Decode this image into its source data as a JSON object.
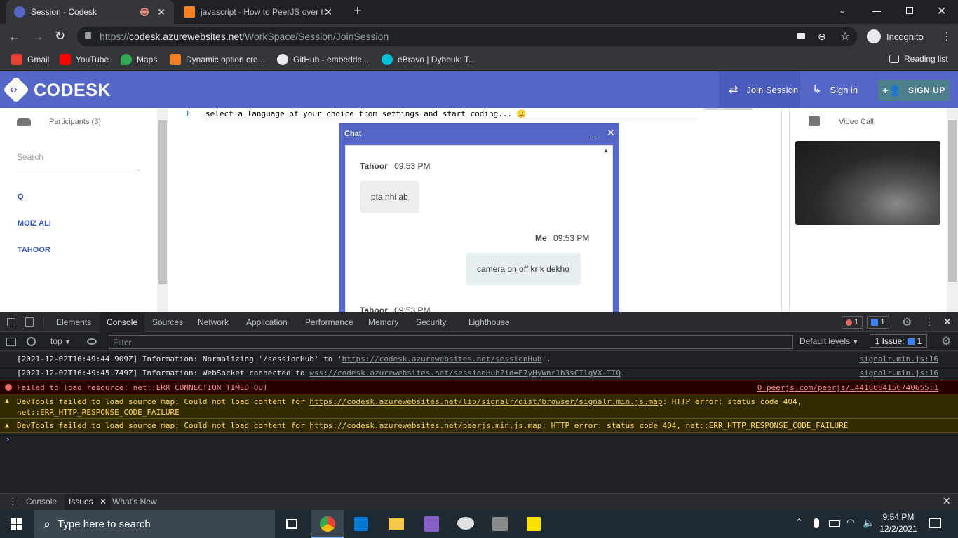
{
  "browser": {
    "tabs": [
      {
        "title": "Session - Codesk",
        "active": true,
        "recording": true
      },
      {
        "title": "javascript - How to PeerJS over th",
        "active": false
      }
    ],
    "address": {
      "scheme": "https://",
      "host": "codesk.azurewebsites.net",
      "path": "/WorkSpace/Session/JoinSession"
    },
    "profile": "Incognito",
    "bookmarks": [
      {
        "label": "Gmail",
        "icon": "gmail-icon"
      },
      {
        "label": "YouTube",
        "icon": "youtube-icon"
      },
      {
        "label": "Maps",
        "icon": "maps-icon"
      },
      {
        "label": "Dynamic option cre...",
        "icon": "stackoverflow-icon"
      },
      {
        "label": "GitHub - embedde...",
        "icon": "github-icon"
      },
      {
        "label": "eBravo | Dybbuk: T...",
        "icon": "ebravo-icon"
      }
    ],
    "reading_list": "Reading list"
  },
  "app": {
    "brand": "CODESK",
    "nav": {
      "join_session": "Join Session",
      "sign_in": "Sign in",
      "sign_up": "SIGN UP"
    },
    "participants_header": "Participants (3)",
    "search_placeholder": "Search",
    "participants": [
      "Q",
      "MOIZ ALI",
      "TAHOOR"
    ],
    "editor": {
      "line_number": "1",
      "line_text": "select a language of your choice from settings and start coding... 😐"
    },
    "video_call_label": "Video Call",
    "chat": {
      "title": "Chat",
      "messages": [
        {
          "sender": "Tahoor",
          "time": "09:53 PM",
          "text": "pta nhi ab",
          "mine": false
        },
        {
          "sender": "Me",
          "time": "09:53 PM",
          "text": "camera on off kr k dekho",
          "mine": true
        },
        {
          "sender": "Tahoor",
          "time": "09:53 PM",
          "text": "",
          "mine": false
        }
      ]
    }
  },
  "devtools": {
    "tabs": [
      "Elements",
      "Console",
      "Sources",
      "Network",
      "Application",
      "Performance",
      "Memory",
      "Security",
      "Lighthouse"
    ],
    "active_tab": "Console",
    "error_count": "1",
    "message_count": "1",
    "context": "top",
    "filter_placeholder": "Filter",
    "levels": "Default levels",
    "issues": "1 Issue:",
    "issues_count": "1",
    "logs": [
      {
        "level": "info",
        "prefix": "[2021-12-02T16:49:44.909Z] Information: Normalizing '/sessionHub' to '",
        "link": "https://codesk.azurewebsites.net/sessionHub",
        "suffix": "'.",
        "source": "signalr.min.js:16"
      },
      {
        "level": "info",
        "prefix": "[2021-12-02T16:49:45.749Z] Information: WebSocket connected to ",
        "link": "wss://codesk.azurewebsites.net/sessionHub?id=E7yHyWnr1b3sCIlqVX-TIQ",
        "suffix": ".",
        "source": "signalr.min.js:16"
      },
      {
        "level": "error",
        "prefix": "Failed to load resource: net::ERR_CONNECTION_TIMED_OUT",
        "link": "",
        "suffix": "",
        "source": "0.peerjs.com/peerjs/…4418664156740655:1"
      },
      {
        "level": "warning",
        "prefix": "DevTools failed to load source map: Could not load content for ",
        "link": "https://codesk.azurewebsites.net/lib/signalr/dist/browser/signalr.min.js.map",
        "suffix": ": HTTP error: status code 404,",
        "line2": "net::ERR_HTTP_RESPONSE_CODE_FAILURE",
        "source": ""
      },
      {
        "level": "warning",
        "prefix": "DevTools failed to load source map: Could not load content for ",
        "link": "https://codesk.azurewebsites.net/peerjs.min.js.map",
        "suffix": ": HTTP error: status code 404, net::ERR_HTTP_RESPONSE_CODE_FAILURE",
        "source": ""
      }
    ],
    "prompt": "›",
    "drawer_tabs": [
      "Console",
      "Issues",
      "What's New"
    ],
    "drawer_active": "Issues"
  },
  "taskbar": {
    "search_placeholder": "Type here to search",
    "time": "9:54 PM",
    "date": "12/2/2021"
  },
  "colors": {
    "brand": "#5566c7",
    "signup": "#4d7f8c",
    "error_bg": "#290000",
    "warning_bg": "#332b00"
  }
}
